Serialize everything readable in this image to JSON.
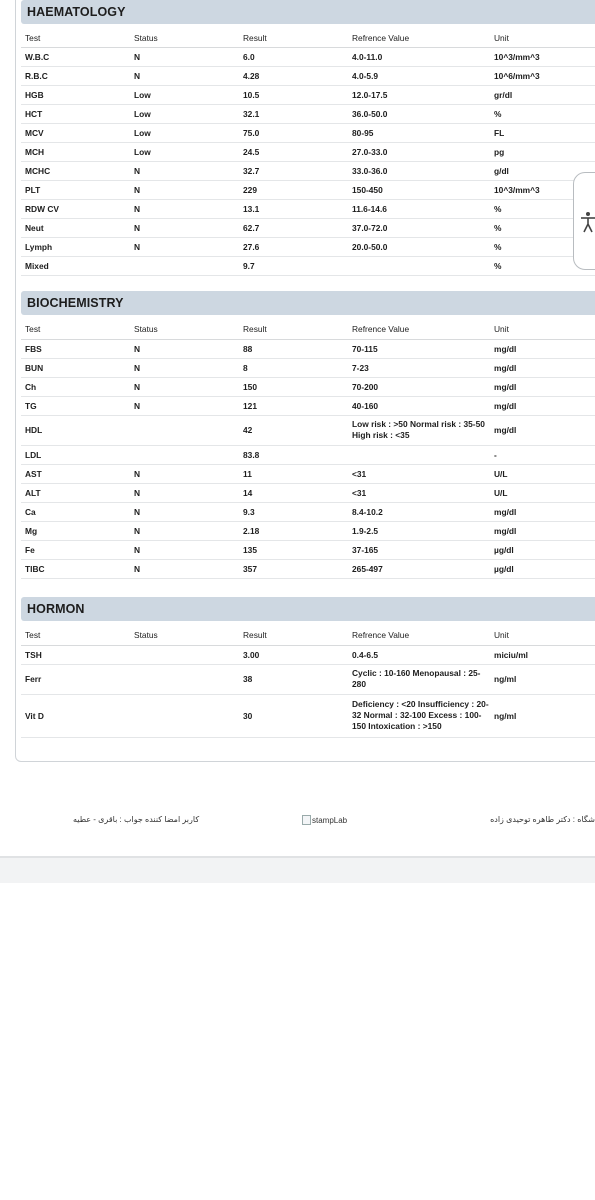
{
  "sections": [
    {
      "title": "HAEMATOLOGY",
      "headers": [
        "Test",
        "Status",
        "Result",
        "Refrence Value",
        "Unit"
      ],
      "rows": [
        [
          "W.B.C",
          "N",
          "6.0",
          "4.0-11.0",
          "10^3/mm^3"
        ],
        [
          "R.B.C",
          "N",
          "4.28",
          "4.0-5.9",
          "10^6/mm^3"
        ],
        [
          "HGB",
          "Low",
          "10.5",
          "12.0-17.5",
          "gr/dl"
        ],
        [
          "HCT",
          "Low",
          "32.1",
          "36.0-50.0",
          "%"
        ],
        [
          "MCV",
          "Low",
          "75.0",
          "80-95",
          "FL"
        ],
        [
          "MCH",
          "Low",
          "24.5",
          "27.0-33.0",
          "pg"
        ],
        [
          "MCHC",
          "N",
          "32.7",
          "33.0-36.0",
          "g/dl"
        ],
        [
          "PLT",
          "N",
          "229",
          "150-450",
          "10^3/mm^3"
        ],
        [
          "RDW CV",
          "N",
          "13.1",
          "11.6-14.6",
          "%"
        ],
        [
          "Neut",
          "N",
          "62.7",
          "37.0-72.0",
          "%"
        ],
        [
          "Lymph",
          "N",
          "27.6",
          "20.0-50.0",
          "%"
        ],
        [
          "Mixed",
          "",
          "9.7",
          "",
          "%"
        ]
      ]
    },
    {
      "title": "BIOCHEMISTRY",
      "headers": [
        "Test",
        "Status",
        "Result",
        "Refrence Value",
        "Unit"
      ],
      "rows": [
        [
          "FBS",
          "N",
          "88",
          "70-115",
          "mg/dl"
        ],
        [
          "BUN",
          "N",
          "8",
          "7-23",
          "mg/dl"
        ],
        [
          "Ch",
          "N",
          "150",
          "70-200",
          "mg/dl"
        ],
        [
          "TG",
          "N",
          "121",
          "40-160",
          "mg/dl"
        ],
        [
          "HDL",
          "",
          "42",
          "Low risk : >50 Normal risk : 35-50 High risk : <35",
          "mg/dl"
        ],
        [
          "LDL",
          "",
          "83.8",
          "",
          "-"
        ],
        [
          "AST",
          "N",
          "11",
          "<31",
          "U/L"
        ],
        [
          "ALT",
          "N",
          "14",
          "<31",
          "U/L"
        ],
        [
          "Ca",
          "N",
          "9.3",
          "8.4-10.2",
          "mg/dl"
        ],
        [
          "Mg",
          "N",
          "2.18",
          "1.9-2.5",
          "mg/dl"
        ],
        [
          "Fe",
          "N",
          "135",
          "37-165",
          "µg/dl"
        ],
        [
          "TIBC",
          "N",
          "357",
          "265-497",
          "µg/dl"
        ]
      ]
    },
    {
      "title": "HORMON",
      "headers": [
        "Test",
        "Status",
        "Result",
        "Refrence Value",
        "Unit"
      ],
      "rows": [
        [
          "TSH",
          "",
          "3.00",
          "0.4-6.5",
          "miciu/ml"
        ],
        [
          "Ferr",
          "",
          "38",
          "Cyclic : 10-160 Menopausal : 25-280",
          "ng/ml"
        ],
        [
          "Vit D",
          "",
          "30",
          "Deficiency : <20 Insufficiency : 20-32 Normal : 32-100 Excess : 100-150 Intoxication : >150",
          "ng/ml"
        ]
      ]
    }
  ],
  "footer": {
    "signer": "کاربر امضا کننده جواب : باقری - عطیه",
    "stamp_alt": "stampLab",
    "doctor": "شگاه : دکتر طاهره توحیدی زاده"
  },
  "icons": {
    "accessibility": "accessibility-icon",
    "broken_image": "broken-image-icon"
  }
}
